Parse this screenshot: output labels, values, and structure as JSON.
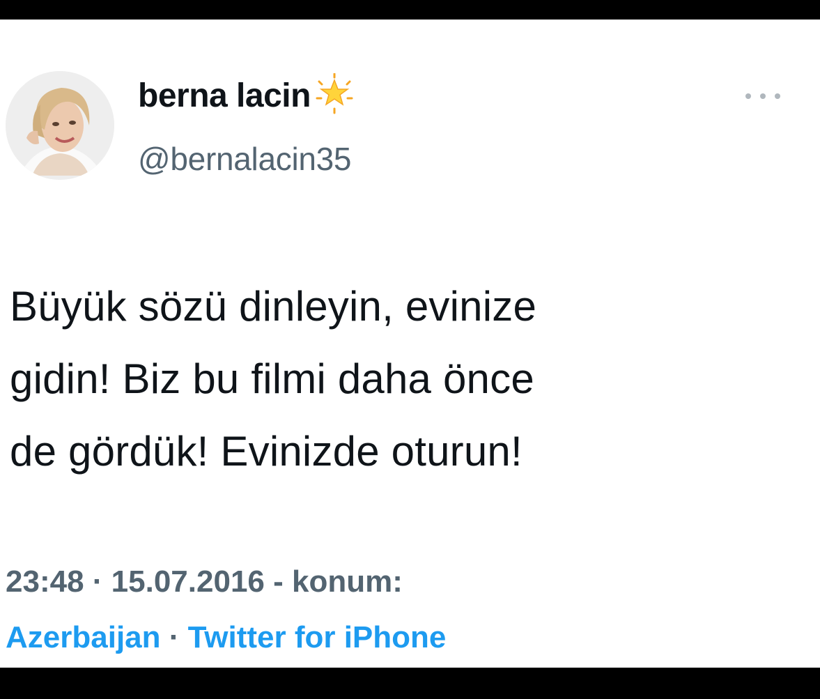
{
  "tweet": {
    "author": {
      "display_name": "berna lacin",
      "handle": "@bernalacin35",
      "badge_icon": "glowing-star-icon",
      "avatar_icon": "profile-photo"
    },
    "more_icon": "more-options-icon",
    "text_lines": [
      "Büyük sözü dinleyin, evinize",
      "gidin! Biz bu filmi daha önce",
      "de gördük! Evinizde oturun!"
    ],
    "meta": {
      "time": "23:48",
      "dot": "·",
      "date": "15.07.2016",
      "location_prefix": "- konum:"
    },
    "source": {
      "location": "Azerbaijan",
      "dot": "·",
      "client": "Twitter for iPhone"
    }
  },
  "colors": {
    "text_primary": "#0f1419",
    "text_secondary": "#536471",
    "link": "#1d9bf0",
    "frame": "#000000"
  }
}
